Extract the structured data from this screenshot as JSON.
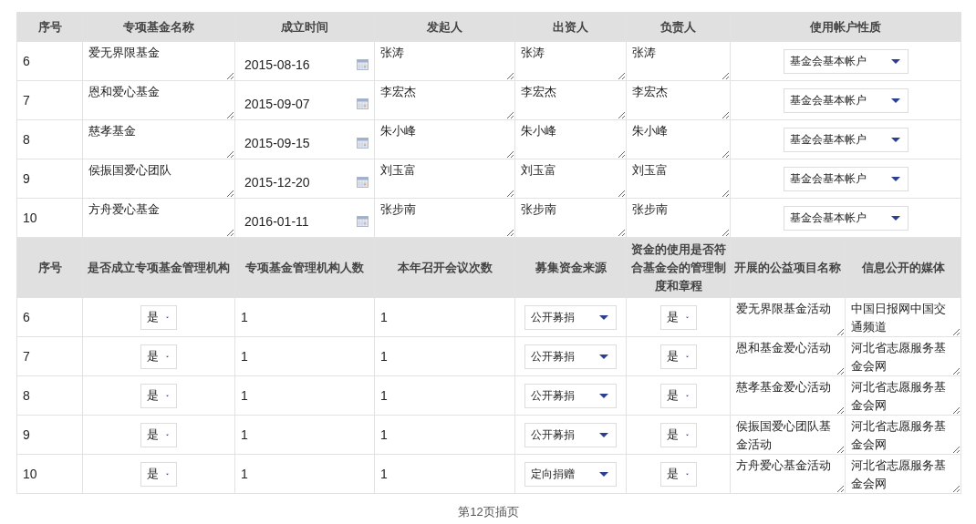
{
  "table_1": {
    "columns": [
      "序号",
      "专项基金名称",
      "成立时间",
      "发起人",
      "出资人",
      "负责人",
      "使用帐户性质"
    ],
    "rows": [
      {
        "index": "6",
        "fund_name": "爱无界限基金",
        "founded_date": "2015-08-16",
        "initiator": "张涛",
        "investor": "张涛",
        "manager": "张涛",
        "account_type": "基金会基本帐户"
      },
      {
        "index": "7",
        "fund_name": "恩和爱心基金",
        "founded_date": "2015-09-07",
        "initiator": "李宏杰",
        "investor": "李宏杰",
        "manager": "李宏杰",
        "account_type": "基金会基本帐户"
      },
      {
        "index": "8",
        "fund_name": "慈孝基金",
        "founded_date": "2015-09-15",
        "initiator": "朱小峰",
        "investor": "朱小峰",
        "manager": "朱小峰",
        "account_type": "基金会基本帐户"
      },
      {
        "index": "9",
        "fund_name": "侯振国爱心团队",
        "founded_date": "2015-12-20",
        "initiator": "刘玉富",
        "investor": "刘玉富",
        "manager": "刘玉富",
        "account_type": "基金会基本帐户"
      },
      {
        "index": "10",
        "fund_name": "方舟爱心基金",
        "founded_date": "2016-01-11",
        "initiator": "张步南",
        "investor": "张步南",
        "manager": "张步南",
        "account_type": "基金会基本帐户"
      }
    ]
  },
  "table_2": {
    "columns": [
      "序号",
      "是否成立专项基金管理机构",
      "专项基金管理机构人数",
      "本年召开会议次数",
      "募集资金来源",
      "资金的使用是否符合基金会的管理制度和章程",
      "开展的公益项目名称",
      "信息公开的媒体"
    ],
    "rows": [
      {
        "index": "6",
        "has_management_body": "是",
        "body_member_count": "1",
        "meetings_this_year": "1",
        "funding_source": "公开募捐",
        "compliant": "是",
        "project_name": "爱无界限基金活动",
        "disclosure_media": "中国日报网中国交通频道"
      },
      {
        "index": "7",
        "has_management_body": "是",
        "body_member_count": "1",
        "meetings_this_year": "1",
        "funding_source": "公开募捐",
        "compliant": "是",
        "project_name": "恩和基金爱心活动",
        "disclosure_media": "河北省志愿服务基金会网"
      },
      {
        "index": "8",
        "has_management_body": "是",
        "body_member_count": "1",
        "meetings_this_year": "1",
        "funding_source": "公开募捐",
        "compliant": "是",
        "project_name": "慈孝基金爱心活动",
        "disclosure_media": "河北省志愿服务基金会网"
      },
      {
        "index": "9",
        "has_management_body": "是",
        "body_member_count": "1",
        "meetings_this_year": "1",
        "funding_source": "公开募捐",
        "compliant": "是",
        "project_name": "侯振国爱心团队基金活动",
        "disclosure_media": "河北省志愿服务基金会网"
      },
      {
        "index": "10",
        "has_management_body": "是",
        "body_member_count": "1",
        "meetings_this_year": "1",
        "funding_source": "定向捐赠",
        "compliant": "是",
        "project_name": "方舟爱心基金活动",
        "disclosure_media": "河北省志愿服务基金会网"
      }
    ]
  },
  "footer": "第12页插页"
}
